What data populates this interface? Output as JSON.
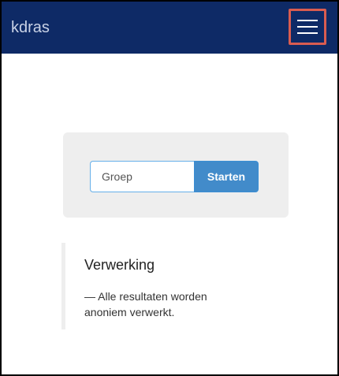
{
  "header": {
    "brand": "kdras",
    "menu_icon": "hamburger-menu-icon"
  },
  "search": {
    "placeholder": "Groep",
    "button_label": "Starten"
  },
  "notice": {
    "title": "Verwerking",
    "text": "— Alle resultaten worden anoniem verwerkt."
  },
  "colors": {
    "navbar": "#0e2a66",
    "highlight": "#d95c50",
    "button": "#428bca",
    "card": "#eeeeee"
  }
}
